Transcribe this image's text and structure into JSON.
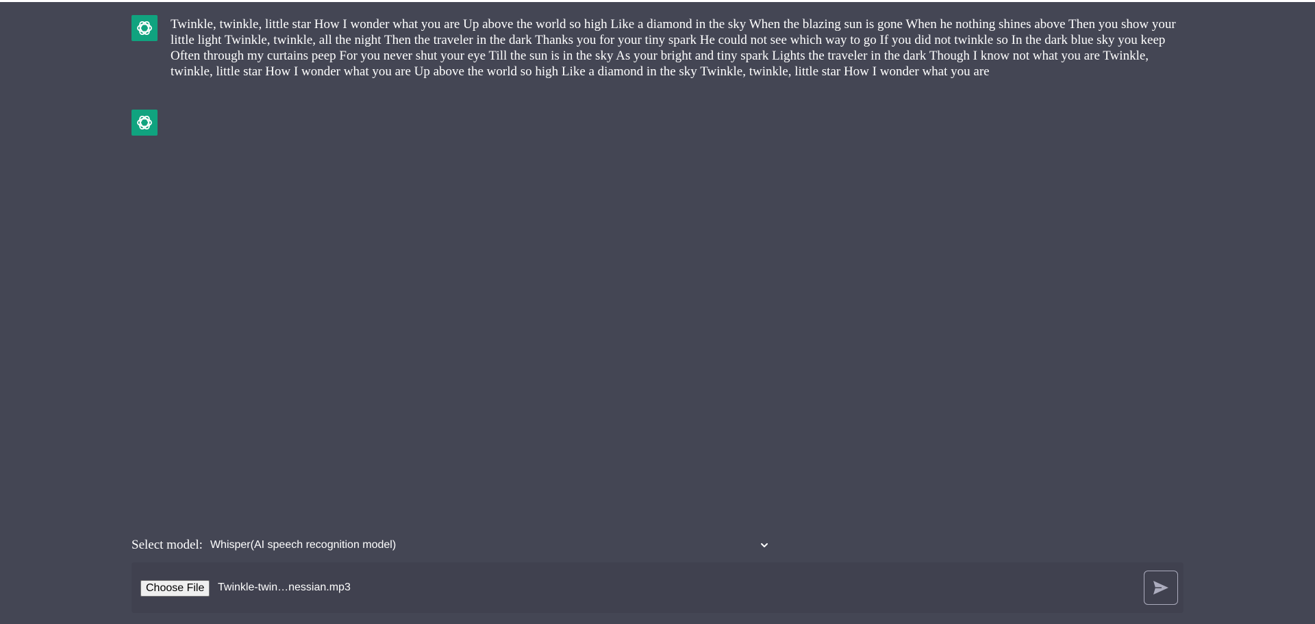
{
  "theme": {
    "background": "#444654",
    "input_bar": "#40414f",
    "avatar_color": "#10a37f",
    "text_color": "#ffffff"
  },
  "messages": [
    {
      "avatar_icon": "openai-logo-icon",
      "text": "Twinkle, twinkle, little star How I wonder what you are Up above the world so high Like a diamond in the sky When the blazing sun is gone When he nothing shines above Then you show your little light Twinkle, twinkle, all the night Then the traveler in the dark Thanks you for your tiny spark He could not see which way to go If you did not twinkle so In the dark blue sky you keep Often through my curtains peep For you never shut your eye Till the sun is in the sky As your bright and tiny spark Lights the traveler in the dark Though I know not what you are Twinkle, twinkle, little star How I wonder what you are Up above the world so high Like a diamond in the sky Twinkle, twinkle, little star How I wonder what you are"
    },
    {
      "avatar_icon": "openai-logo-icon",
      "text": ""
    }
  ],
  "model_selector": {
    "label": "Select model:",
    "selected": "Whisper(AI speech recognition model)",
    "icon": "chevron-down-icon"
  },
  "input": {
    "choose_file_label": "Choose File",
    "file_name": "Twinkle-twin…nessian.mp3",
    "send_icon": "send-icon"
  }
}
